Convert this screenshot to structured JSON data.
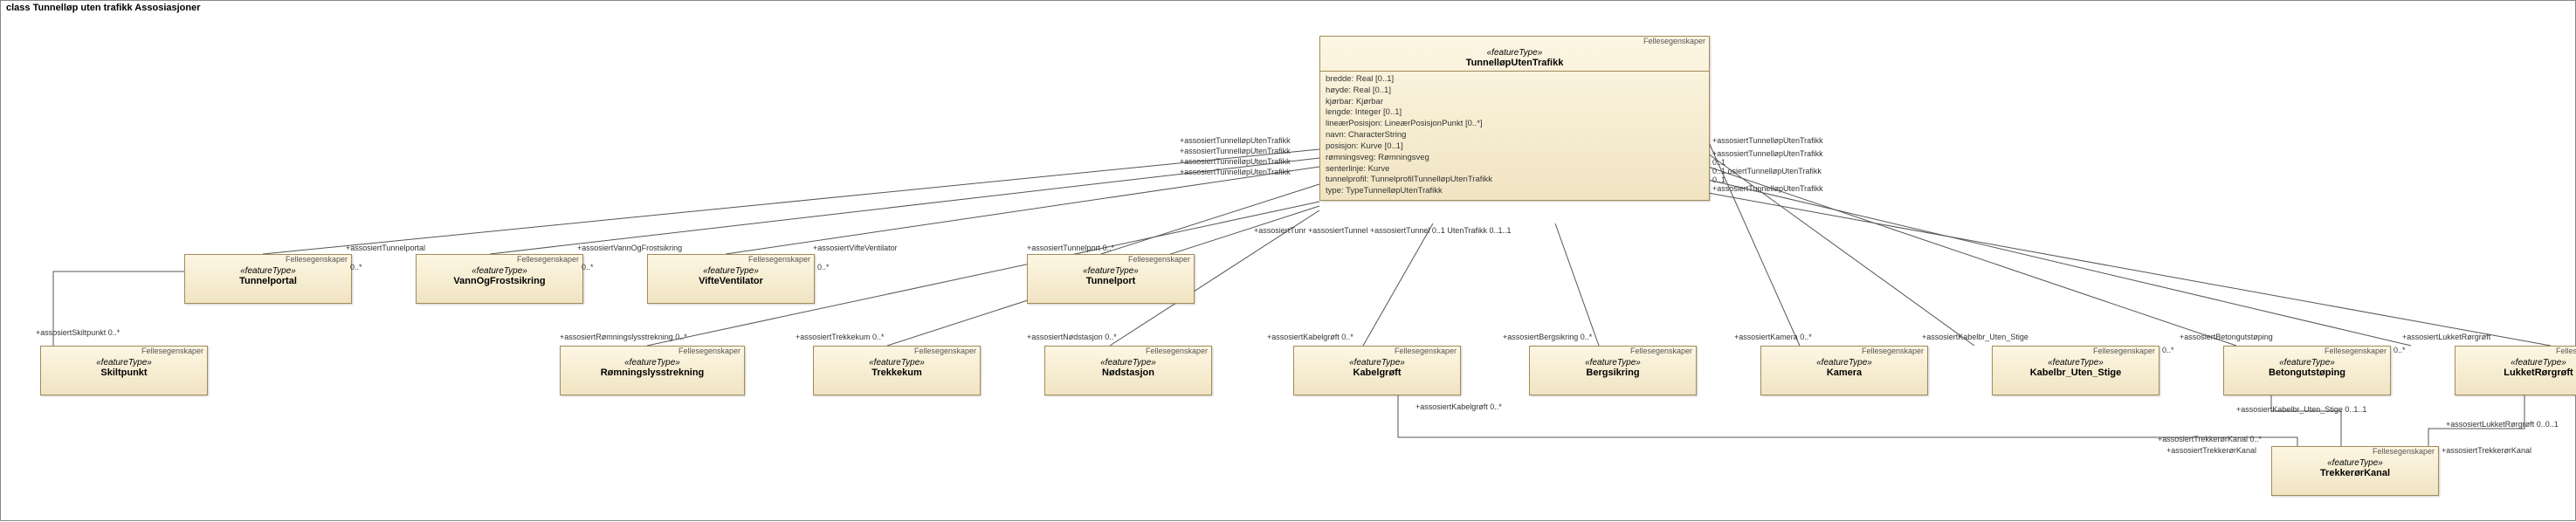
{
  "diagram_title": "class Tunnelløp uten trafikk Assosiasjoner",
  "stereotype_top": "Fellesegenskaper",
  "stereotype_mid": "«featureType»",
  "main": {
    "name": "TunnelløpUtenTrafikk",
    "attrs": [
      "bredde: Real [0..1]",
      "høyde: Real [0..1]",
      "kjørbar: Kjørbar",
      "lengde: Integer [0..1]",
      "lineærPosisjon: LineærPosisjonPunkt [0..*]",
      "navn: CharacterString",
      "posisjon: Kurve [0..1]",
      "rømningsveg: Rømningsveg",
      "senterlinje: Kurve",
      "tunnelprofil: TunnelprofilTunnelløpUtenTrafikk",
      "type: TypeTunnelløpUtenTrafikk"
    ]
  },
  "classes": {
    "tunnelportal": {
      "name": "Tunnelportal"
    },
    "vannogfrost": {
      "name": "VannOgFrostsikring"
    },
    "vifteventilator": {
      "name": "VifteVentilator"
    },
    "tunnelport": {
      "name": "Tunnelport"
    },
    "skiltpunkt": {
      "name": "Skiltpunkt"
    },
    "romningslys": {
      "name": "Rømningslysstrekning"
    },
    "trekkekum": {
      "name": "Trekkekum"
    },
    "nodstasjon": {
      "name": "Nødstasjon"
    },
    "kabelgroft": {
      "name": "Kabelgrøft"
    },
    "bergsikring": {
      "name": "Bergsikring"
    },
    "kamera": {
      "name": "Kamera"
    },
    "kabelbr": {
      "name": "Kabelbr_Uten_Stige"
    },
    "betong": {
      "name": "Betongutstøping"
    },
    "lukketror": {
      "name": "LukketRørgrøft"
    },
    "trekkeror": {
      "name": "TrekkerørKanal"
    }
  },
  "edge_labels": {
    "l_tunnelportal": "+assosiertTunnelportal",
    "l_vannogfrost": "+assosiertVannOgFrostsikring",
    "l_vifte": "+assosiertVifteVentilator",
    "l_tunnelport": "+assosiertTunnelport  0..*",
    "l_skiltpunkt": "+assosiertSkiltpunkt 0..*",
    "l_romning": "+assosiertRømningslysstrekning 0..*",
    "l_trekkekum": "+assosiertTrekkekum  0..*",
    "l_nodstasjon": "+assosiertNødstasjon  0..*",
    "l_kabelgroft": "+assosiertKabelgrøft  0..*",
    "l_bergsikring": "+assosiertBergsikring  0..*",
    "l_kamera": "+assosiertKamera 0..*",
    "l_kabelbr": "+assosiertKabelbr_Uten_Stige",
    "l_betong": "+assosiertBetongutstøping",
    "l_lukketror": "+assosiertLukketRørgrøft",
    "l_trekkeror": "+assosiertTrekkerørKanal",
    "l_trekkerorR": "+assosiertTrekkerørKanal",
    "l_trekkerorK": "+assosiertTrekkerørKanal 0..*",
    "l_kabelbrUS": "+assosiertKabelbr_Uten_Stige  0..1..1",
    "l_kabelgroft2": "+assosiertKabelgrøft  0..*",
    "l_lukketror2": "+assosiertLukketRørgrøft  0..0..1",
    "l_main_r1": "+assosiertTunnelløpUtenTrafikk",
    "l_main_r2": "+assosiertTunnelløpUtenTrafikk",
    "l_main_r3": "0..1 osiertTunnelløpUtenTrafikk",
    "l_main_r4": "+assosiertTunnelløpUtenTrafikk",
    "l_main_l1": "+assosiertTunnelløpUtenTrafikk",
    "l_main_l2": "+assosiertTunnelløpUtenTrafikk",
    "l_main_l3": "+assosiertTunnelløpUtenTrafikk",
    "l_main_l4": "+assosiertTunnelløpUtenTrafikk",
    "l_tunr": "+assosiertTunr +assosiertTunnel +assosiertTunnel 0..1 UtenTrafikk  0..1..1",
    "m_01": "0..1",
    "m_0s": "0..*",
    "m_01a": "0..1..1",
    "m_001": "0..0..1"
  },
  "chart_data": {
    "type": "uml-class-diagram",
    "root": "TunnelløpUtenTrafikk",
    "associations": [
      {
        "from": "TunnelløpUtenTrafikk",
        "to": "Tunnelportal",
        "role": "assosiertTunnelportal",
        "mult": "0..*",
        "back_role": "assosiertTunnelløpUtenTrafikk",
        "back_mult": "0..1"
      },
      {
        "from": "TunnelløpUtenTrafikk",
        "to": "VannOgFrostsikring",
        "role": "assosiertVannOgFrostsikring",
        "mult": "0..*",
        "back_role": "assosiertTunnelløpUtenTrafikk",
        "back_mult": "0..1"
      },
      {
        "from": "TunnelløpUtenTrafikk",
        "to": "VifteVentilator",
        "role": "assosiertVifteVentilator",
        "mult": "0..*",
        "back_role": "assosiertTunnelløpUtenTrafikk",
        "back_mult": "0..1"
      },
      {
        "from": "TunnelløpUtenTrafikk",
        "to": "Tunnelport",
        "role": "assosiertTunnelport",
        "mult": "0..*",
        "back_role": "assosiertTunnelløpUtenTrafikk",
        "back_mult": "0..1"
      },
      {
        "from": "TunnelløpUtenTrafikk",
        "to": "Skiltpunkt",
        "role": "assosiertSkiltpunkt",
        "mult": "0..*",
        "back_role": "assosiertTunnelløpUtenTrafikk",
        "back_mult": "0..1"
      },
      {
        "from": "TunnelløpUtenTrafikk",
        "to": "Rømningslysstrekning",
        "role": "assosiertRømningslysstrekning",
        "mult": "0..*",
        "back_role": "assosiertTunnelløpUtenTrafikk",
        "back_mult": "0..1"
      },
      {
        "from": "TunnelløpUtenTrafikk",
        "to": "Trekkekum",
        "role": "assosiertTrekkekum",
        "mult": "0..*",
        "back_role": "assosiertTunnelløpUtenTrafikk",
        "back_mult": "0..1"
      },
      {
        "from": "TunnelløpUtenTrafikk",
        "to": "Nødstasjon",
        "role": "assosiertNødstasjon",
        "mult": "0..*",
        "back_role": "assosiertTunnelløpUtenTrafikk",
        "back_mult": "0..1"
      },
      {
        "from": "TunnelløpUtenTrafikk",
        "to": "Kabelgrøft",
        "role": "assosiertKabelgrøft",
        "mult": "0..*",
        "back_role": "assosiertTunnelløpUtenTrafikk",
        "back_mult": "0..1"
      },
      {
        "from": "TunnelløpUtenTrafikk",
        "to": "Bergsikring",
        "role": "assosiertBergsikring",
        "mult": "0..*",
        "back_role": "assosiertTunnelløpUtenTrafikk",
        "back_mult": "0..1"
      },
      {
        "from": "TunnelløpUtenTrafikk",
        "to": "Kamera",
        "role": "assosiertKamera",
        "mult": "0..*",
        "back_role": "assosiertTunnelløpUtenTrafikk",
        "back_mult": "0..1"
      },
      {
        "from": "TunnelløpUtenTrafikk",
        "to": "Kabelbr_Uten_Stige",
        "role": "assosiertKabelbr_Uten_Stige",
        "mult": "0..*",
        "back_role": "assosiertTunnelløpUtenTrafikk",
        "back_mult": "0..1"
      },
      {
        "from": "TunnelløpUtenTrafikk",
        "to": "Betongutstøping",
        "role": "assosiertBetongutstøping",
        "mult": "0..*",
        "back_role": "assosiertTunnelløpUtenTrafikk",
        "back_mult": "0..1"
      },
      {
        "from": "TunnelløpUtenTrafikk",
        "to": "LukketRørgrøft",
        "role": "assosiertLukketRørgrøft",
        "mult": "0..*",
        "back_role": "assosiertTunnelløpUtenTrafikk",
        "back_mult": "0..1"
      },
      {
        "from": "Kabelgrøft",
        "to": "TrekkerørKanal",
        "role": "assosiertTrekkerørKanal",
        "mult": "0..*",
        "back_role": "assosiertKabelgrøft",
        "back_mult": "0..*"
      },
      {
        "from": "Kabelbr_Uten_Stige",
        "to": "TrekkerørKanal",
        "role": "assosiertTrekkerørKanal",
        "mult": "0..*",
        "back_role": "assosiertKabelbr_Uten_Stige",
        "back_mult": "0..1..1"
      },
      {
        "from": "LukketRørgrøft",
        "to": "TrekkerørKanal",
        "role": "assosiertTrekkerørKanal",
        "mult": "0..*",
        "back_role": "assosiertLukketRørgrøft",
        "back_mult": "0..0..1"
      }
    ]
  }
}
